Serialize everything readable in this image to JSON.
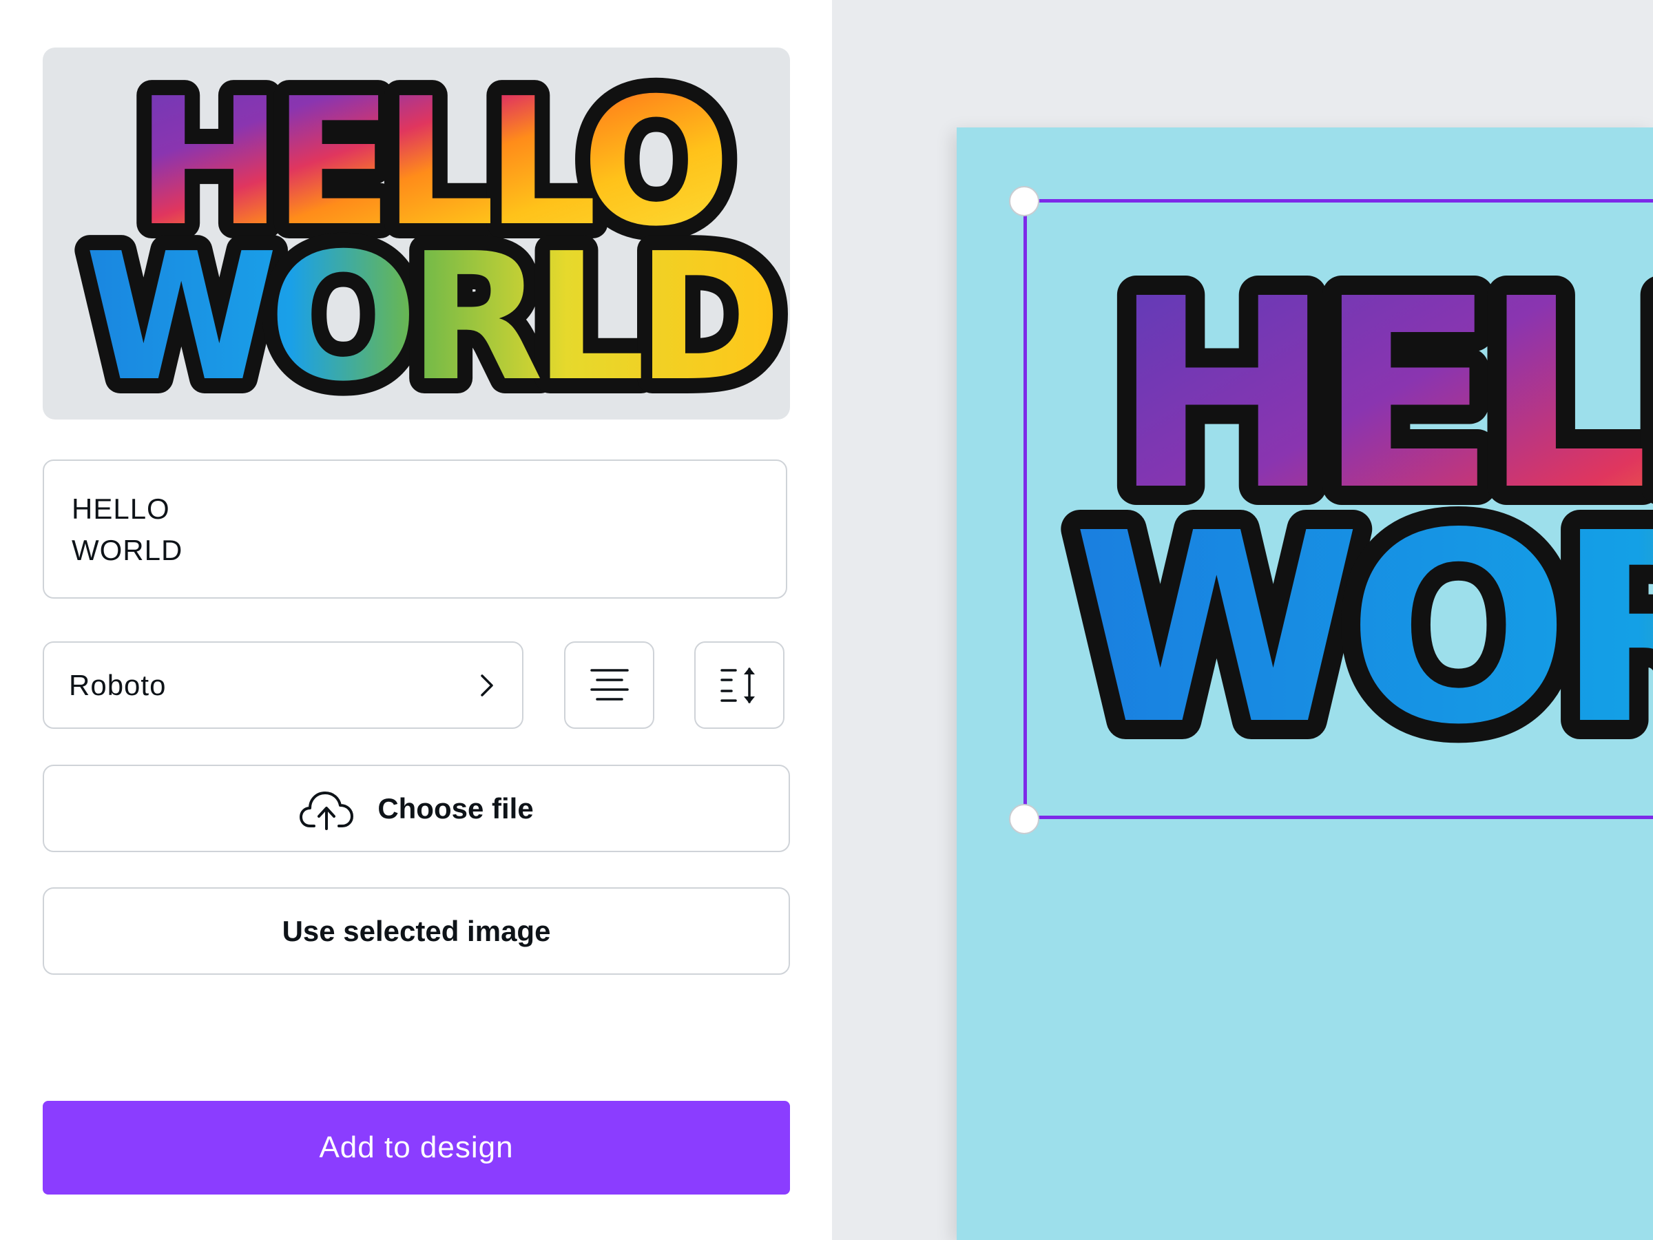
{
  "preview": {
    "line1": "HELLO",
    "line2": "WORLD"
  },
  "text_input": {
    "value": "HELLO\nWORLD"
  },
  "font_select": {
    "value": "Roboto",
    "chevron_icon": "chevron-right-icon"
  },
  "toolbar": {
    "align_icon": "align-center-icon",
    "spacing_icon": "line-spacing-icon"
  },
  "buttons": {
    "choose_file": "Choose file",
    "upload_icon": "cloud-upload-icon",
    "use_selected": "Use selected image",
    "add_to_design": "Add to design"
  },
  "canvas": {
    "line1": "HELLO",
    "line2": "WORLD",
    "page_color": "#9ddfeb",
    "selection_color": "#7d2ae8"
  },
  "colors": {
    "accent": "#8b3dff"
  }
}
